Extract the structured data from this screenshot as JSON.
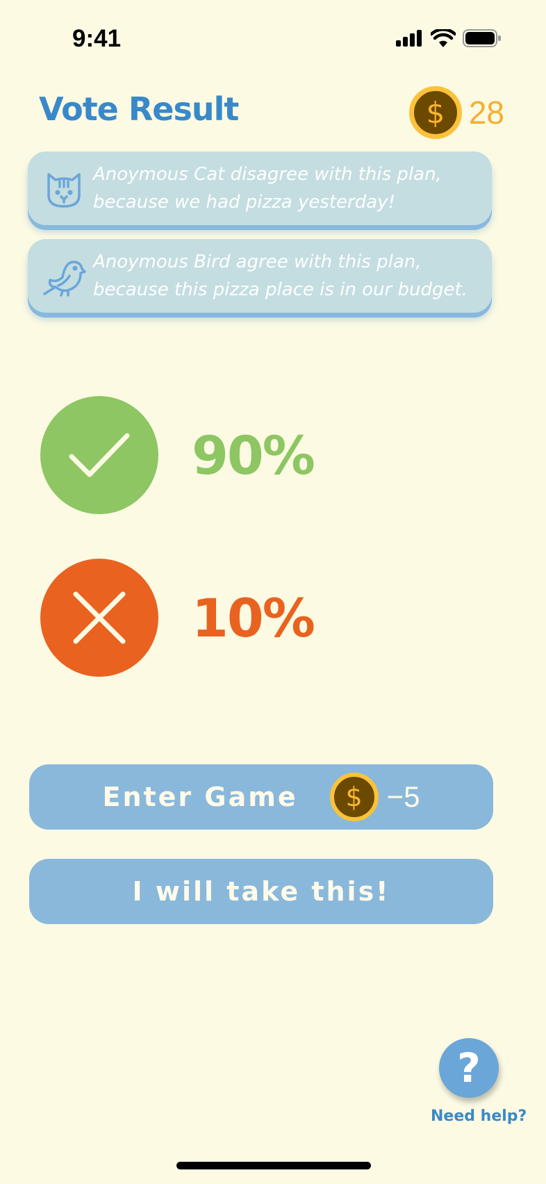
{
  "status_bar": {
    "time": "9:41"
  },
  "header": {
    "title": "Vote Result",
    "coin_count": "28",
    "coin_symbol": "$"
  },
  "comments": [
    {
      "avatar_icon": "cat-icon",
      "line1": "Anoymous Cat disagree with this plan,",
      "line2": "because we had pizza yesterday!"
    },
    {
      "avatar_icon": "bird-icon",
      "line1": "Anoymous Bird agree with this plan,",
      "line2": "because this pizza place is in our budget."
    }
  ],
  "votes": {
    "agree": {
      "percent_label": "90%",
      "percent": 90,
      "color": "#8dc663",
      "icon": "check-icon"
    },
    "disagree": {
      "percent_label": "10%",
      "percent": 10,
      "color": "#ea6220",
      "icon": "x-icon"
    }
  },
  "actions": {
    "enter_game_label": "Enter Game",
    "enter_game_cost": "−5",
    "coin_symbol": "$",
    "take_label": "I will take this!"
  },
  "help": {
    "symbol": "?",
    "label": "Need help?"
  },
  "colors": {
    "background": "#fcfae3",
    "accent": "#3889c9",
    "button": "#8ab8db",
    "coin": "#fbc23a"
  }
}
